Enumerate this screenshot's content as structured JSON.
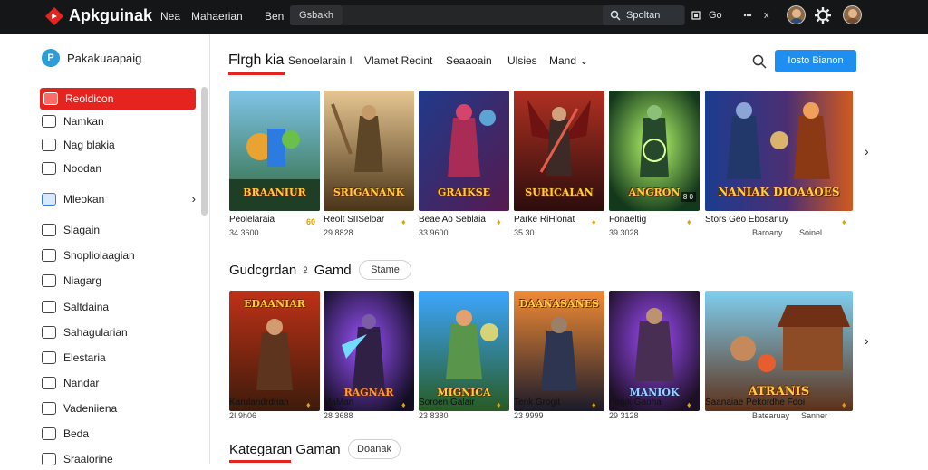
{
  "topbar": {
    "logo": "Apkguinak",
    "links": [
      "Nea",
      "Mahaerian",
      "Ben"
    ],
    "pill": "Gsbakh",
    "search": "Spoltan",
    "small_icons": [
      "Go",
      "x"
    ],
    "colors": {
      "background": "#151617",
      "accent": "#e52420"
    }
  },
  "sidebar": {
    "brand": "Pakakuaapaig",
    "items": [
      {
        "label": "Reoldicon",
        "active": true
      },
      {
        "label": "Namkan"
      },
      {
        "label": "Nag blakia"
      },
      {
        "label": "Noodan"
      },
      {
        "label": "Mleokan",
        "has_chevron": true
      },
      {
        "label": "Slagain"
      },
      {
        "label": "Snopliolaagian"
      },
      {
        "label": "Niagarg"
      },
      {
        "label": "Saltdaina"
      },
      {
        "label": "Sahagularian"
      },
      {
        "label": "Elestaria"
      },
      {
        "label": "Nandar"
      },
      {
        "label": "Vadeniiena"
      },
      {
        "label": "Beda"
      },
      {
        "label": "Sraalorine"
      }
    ]
  },
  "main": {
    "tabs": [
      {
        "label": "Flrgh kia",
        "active": true
      },
      {
        "label": "Senoelarain I"
      },
      {
        "label": "Vlamet Reoint"
      },
      {
        "label": "Seaaoain"
      },
      {
        "label": "Ulsies"
      },
      {
        "label": "Mand ⌄"
      }
    ],
    "cta": "Iosto Bianon",
    "row1": {
      "cards": [
        {
          "art": "BRAANIUR",
          "title": "Peolelaraia",
          "sub": "34 3600",
          "badge": "60"
        },
        {
          "art": "SRIGANANK",
          "title": "Reolt SIISeloar",
          "sub": "29 8828",
          "badge": "♦"
        },
        {
          "art": "GRAIKSE",
          "title": "Beae Ao Seblaia",
          "sub": "33 9600",
          "badge": "♦"
        },
        {
          "art": "SURICALAN",
          "title": "Parke RiHlonat",
          "sub": "35 30",
          "badge": "♦"
        },
        {
          "art": "ANGRON",
          "title": "Fonaeltig",
          "sub": "39 3028",
          "badge": "♦"
        },
        {
          "art": "NANIAK DIOAAOES",
          "title": "Stors Geo Ebosanuy",
          "sub": "Baroany",
          "badge": "♦",
          "sub2": "Soinel"
        }
      ]
    },
    "section2": {
      "title": "Gudcgrdan ♀ Gamd",
      "pill": "Stame"
    },
    "row2": {
      "cards": [
        {
          "art": "EDAANIAR",
          "title": "Karulandrdrian",
          "sub": "2I 9h06",
          "badge": "♦"
        },
        {
          "art": "RAGNAR",
          "title": "MaMan",
          "sub": "28 3688",
          "badge": "♦"
        },
        {
          "art": "MIGNICA",
          "title": "Soroen Galair",
          "sub": "23 8380",
          "badge": "♦"
        },
        {
          "art": "DAANASANES",
          "title": "Tenk Grogit",
          "sub": "23 9999",
          "badge": "♦"
        },
        {
          "art": "MANIOK",
          "title": "Penik Gaoha",
          "sub": "29 3128",
          "badge": "♦"
        },
        {
          "art": "ATRANIS",
          "title": "Saanaiae Pekordhe Fdoi",
          "sub": "Batearuay",
          "badge": "♦",
          "sub2": "Sanner"
        }
      ]
    },
    "section3": {
      "title": "Kategaran Gaman",
      "pill": "Doanak"
    }
  }
}
